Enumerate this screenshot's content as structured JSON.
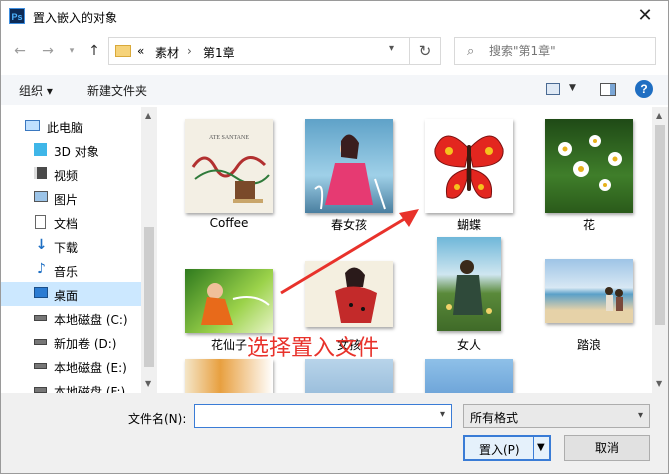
{
  "window": {
    "title": "置入嵌入的对象",
    "app_icon": "Ps",
    "close": "✕"
  },
  "address": {
    "prefix": "«",
    "segments": [
      "素材",
      "第1章"
    ],
    "separator": "›",
    "search_placeholder": "搜索\"第1章\""
  },
  "toolbar": {
    "organize": "组织 ▾",
    "new_folder": "新建文件夹",
    "help": "?"
  },
  "nav": {
    "items": [
      {
        "label": "此电脑",
        "icon": "computer-icon"
      },
      {
        "label": "3D 对象",
        "icon": "cube-3d-icon"
      },
      {
        "label": "视频",
        "icon": "video-icon"
      },
      {
        "label": "图片",
        "icon": "pictures-icon"
      },
      {
        "label": "文档",
        "icon": "documents-icon"
      },
      {
        "label": "下载",
        "icon": "download-icon"
      },
      {
        "label": "音乐",
        "icon": "music-icon"
      },
      {
        "label": "桌面",
        "icon": "desktop-icon",
        "selected": true
      },
      {
        "label": "本地磁盘 (C:)",
        "icon": "drive-icon"
      },
      {
        "label": "新加卷 (D:)",
        "icon": "drive-icon"
      },
      {
        "label": "本地磁盘 (E:)",
        "icon": "drive-icon"
      },
      {
        "label": "本地磁盘 (F:)",
        "icon": "drive-icon"
      }
    ]
  },
  "files": [
    {
      "label": "Coffee"
    },
    {
      "label": "春女孩"
    },
    {
      "label": "蝴蝶"
    },
    {
      "label": "花"
    },
    {
      "label": "花仙子"
    },
    {
      "label": "女孩"
    },
    {
      "label": "女人"
    },
    {
      "label": "踏浪"
    }
  ],
  "annotation": "选择置入文件",
  "footer": {
    "filename_label": "文件名(N):",
    "filename_value": "",
    "filetype": "所有格式",
    "place_button": "置入(P)",
    "cancel_button": "取消"
  }
}
